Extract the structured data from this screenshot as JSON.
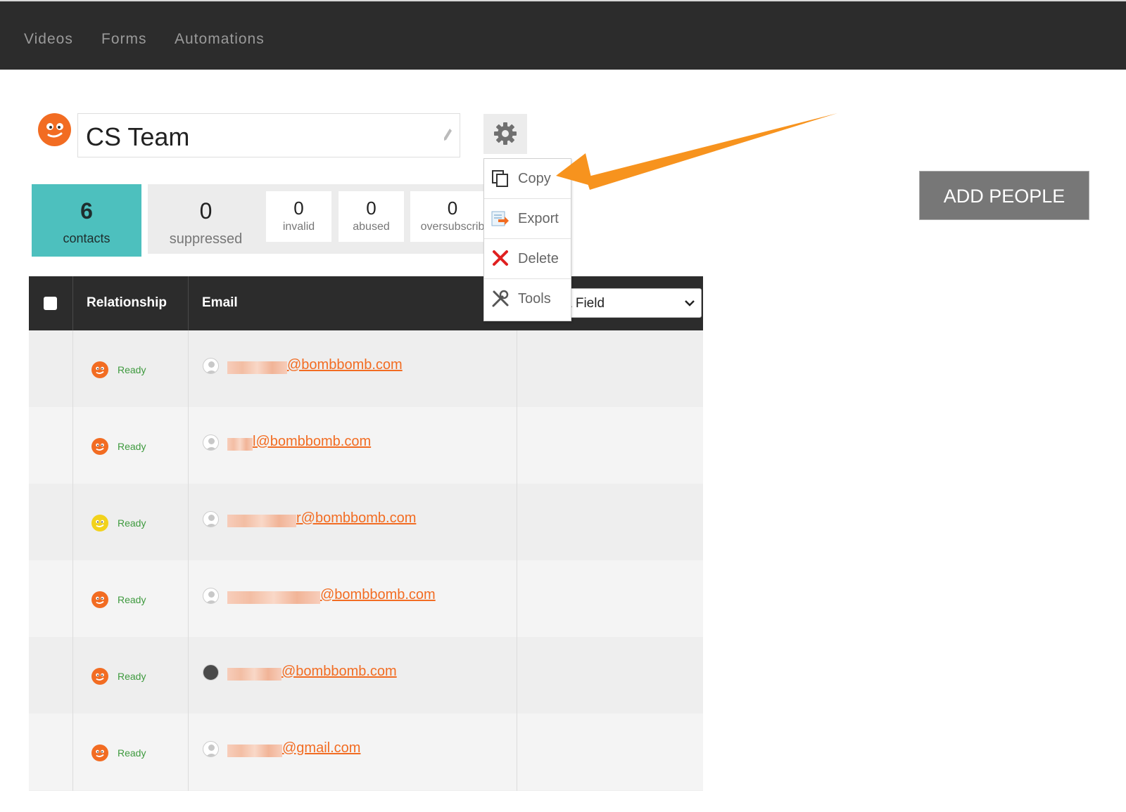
{
  "nav": {
    "items": [
      "Videos",
      "Forms",
      "Automations"
    ]
  },
  "list": {
    "name": "CS Team"
  },
  "stats": {
    "contacts": {
      "value": "6",
      "label": "contacts"
    },
    "suppressed": {
      "value": "0",
      "label": "suppressed"
    },
    "invalid": {
      "value": "0",
      "label": "invalid"
    },
    "abused": {
      "value": "0",
      "label": "abused"
    },
    "oversubscribed": {
      "value": "0",
      "label": "oversubscrib"
    }
  },
  "add_people_label": "ADD PEOPLE",
  "table": {
    "headers": {
      "relationship": "Relationship",
      "email": "Email"
    },
    "field_select": {
      "selected": "a Field"
    },
    "rows": [
      {
        "status": "Ready",
        "status_color": "#f26c22",
        "email": "@bombbomb.com"
      },
      {
        "status": "Ready",
        "status_color": "#f26c22",
        "email": "l@bombbomb.com"
      },
      {
        "status": "Ready",
        "status_color": "#f2d21c",
        "email": "r@bombbomb.com"
      },
      {
        "status": "Ready",
        "status_color": "#f26c22",
        "email": "@bombbomb.com"
      },
      {
        "status": "Ready",
        "status_color": "#f26c22",
        "email": "@bombbomb.com"
      },
      {
        "status": "Ready",
        "status_color": "#f26c22",
        "email": "@gmail.com"
      }
    ]
  },
  "menu": {
    "items": [
      {
        "label": "Copy",
        "icon": "copy-icon"
      },
      {
        "label": "Export",
        "icon": "export-icon"
      },
      {
        "label": "Delete",
        "icon": "delete-x-icon"
      },
      {
        "label": "Tools",
        "icon": "tools-icon"
      }
    ]
  },
  "colors": {
    "accent": "#f26c22",
    "teal": "#4dc0be",
    "topbar": "#2c2c2c",
    "annotation_arrow": "#f7931e"
  }
}
